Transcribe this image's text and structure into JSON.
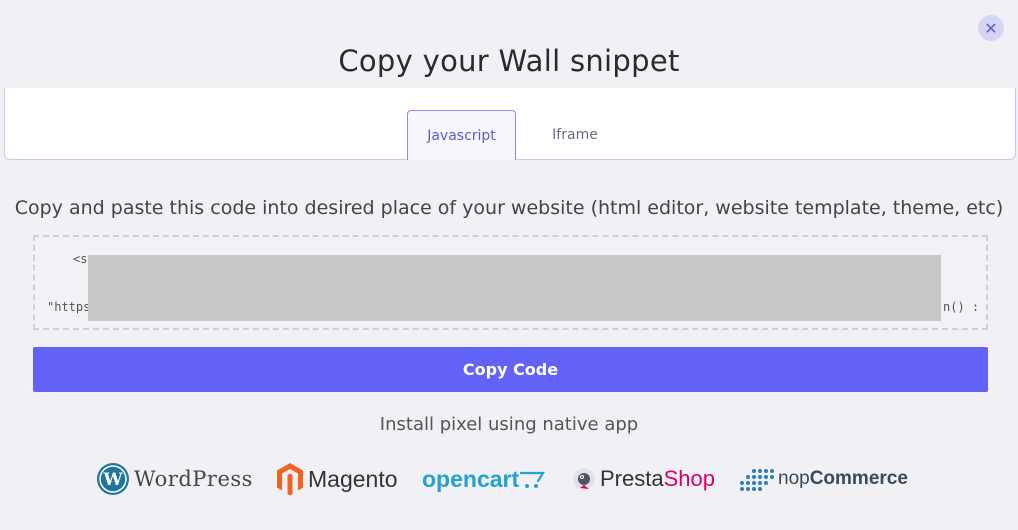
{
  "modal": {
    "title": "Copy your Wall snippet",
    "close_glyph": "✕"
  },
  "tabs": [
    {
      "label": "Javascript",
      "active": true
    },
    {
      "label": "Iframe",
      "active": false
    }
  ],
  "instructions": "Copy and paste this code into desired place of your website (html editor, website template, theme, etc)",
  "code": {
    "line1_start": "<s",
    "line2_start": "\"https:",
    "line2_end": "n() :"
  },
  "copy_button": "Copy Code",
  "install_label": "Install pixel using native app",
  "apps": {
    "wordpress": "WordPress",
    "magento": "Magento",
    "opencart": "opencart",
    "prestashop_a": "Presta",
    "prestashop_b": "Shop",
    "nop_a": "nop",
    "nop_b": "Commerce"
  },
  "colors": {
    "accent": "#6262f7",
    "tab_active": "#5b5bd6",
    "wordpress": "#21759b",
    "magento": "#f26322",
    "opencart": "#23a1d1",
    "prestashop": "#df0067",
    "nopcommerce": "#2c7fb8"
  },
  "icons": {
    "close": "close-icon",
    "wordpress": "wordpress-logo-icon",
    "magento": "magento-logo-icon",
    "opencart": "opencart-cart-icon",
    "prestashop": "prestashop-logo-icon",
    "nopcommerce": "nopcommerce-dots-icon"
  }
}
